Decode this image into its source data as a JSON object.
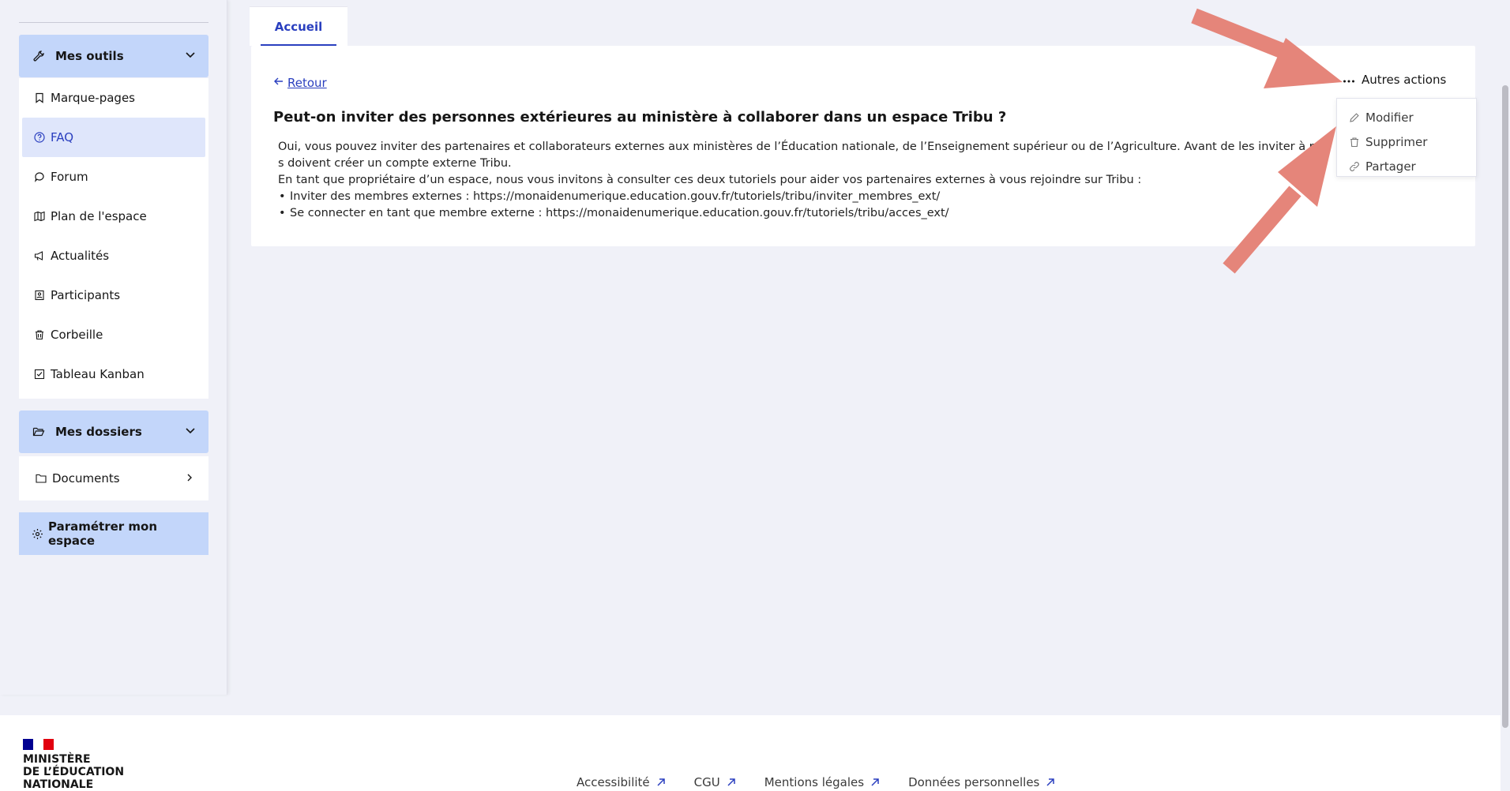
{
  "sidebar": {
    "tools_header": "Mes outils",
    "tools": [
      {
        "label": "Marque-pages",
        "icon": "bookmark-icon"
      },
      {
        "label": "FAQ",
        "icon": "help-circle-icon",
        "active": true
      },
      {
        "label": "Forum",
        "icon": "chat-bubble-icon"
      },
      {
        "label": "Plan de l'espace",
        "icon": "map-icon"
      },
      {
        "label": "Actualités",
        "icon": "megaphone-icon"
      },
      {
        "label": "Participants",
        "icon": "contact-card-icon"
      },
      {
        "label": "Corbeille",
        "icon": "trash-icon"
      },
      {
        "label": "Tableau Kanban",
        "icon": "checkbox-icon"
      }
    ],
    "folders_header": "Mes dossiers",
    "folders": [
      {
        "label": "Documents",
        "icon": "folder-icon"
      }
    ],
    "settings_button": "Paramétrer mon espace"
  },
  "tabs": [
    {
      "label": "Accueil",
      "active": true
    }
  ],
  "main": {
    "back_label": "Retour",
    "title": "Peut-on inviter des personnes extérieures au ministère à collaborer dans un espace Tribu ?",
    "paragraph_1a": "Oui, vous pouvez inviter des partenaires et collaborateurs externes aux ministères de l’Éducation nationale, de l’Enseignement supérieur ou de l’Agriculture. Avant de les inviter à rejoindre votre espace, ils doivent créer un compte externe Tribu.",
    "paragraph_1b": "s doivent créer un compte externe Tribu.",
    "paragraph_2": "En tant que propriétaire d’un espace, nous vous invitons à consulter ces deux tutoriels pour aider vos partenaires externes à vous rejoindre sur Tribu :",
    "bullets": [
      "Inviter des membres externes : https://monaidenumerique.education.gouv.fr/tutoriels/tribu/inviter_membres_ext/",
      "Se connecter en tant que membre externe : https://monaidenumerique.education.gouv.fr/tutoriels/tribu/acces_ext/"
    ]
  },
  "actions": {
    "label": "Autres actions",
    "menu": [
      {
        "label": "Modifier",
        "icon": "pencil-icon"
      },
      {
        "label": "Supprimer",
        "icon": "trash-icon"
      },
      {
        "label": "Partager",
        "icon": "link-icon"
      }
    ]
  },
  "footer": {
    "ministry_line1": "MINISTÈRE",
    "ministry_line2": "DE L’ÉDUCATION",
    "ministry_line3": "NATIONALE",
    "links": [
      "Accessibilité",
      "CGU",
      "Mentions légales",
      "Données personnelles"
    ]
  },
  "colors": {
    "accent": "#2a3fbf",
    "header_bg": "#c3d6fa",
    "annotation_arrow": "#e5857a"
  }
}
